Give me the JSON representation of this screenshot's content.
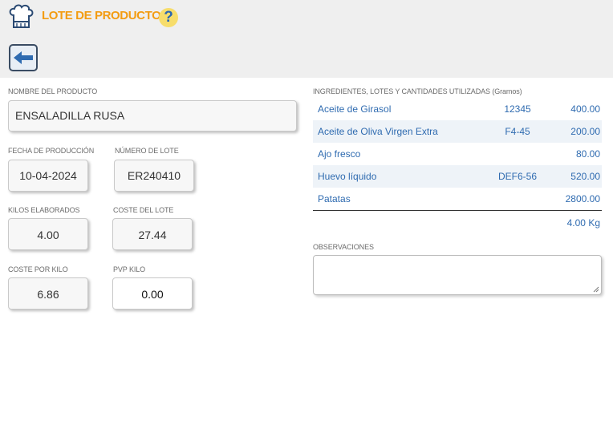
{
  "header": {
    "title": "LOTE DE PRODUCTO",
    "help_icon": "?",
    "icons": {
      "app": "chef-hat-icon",
      "help": "help-icon",
      "back": "back-arrow-icon"
    },
    "accent_color": "#f39c12",
    "link_color": "#2f6bb0"
  },
  "product": {
    "name_label": "NOMBRE DEL PRODUCTO",
    "name_value": "ENSALADILLA RUSA",
    "date_label": "FECHA DE PRODUCCIÓN",
    "date_value": "10-04-2024",
    "lot_label": "NÚMERO DE LOTE",
    "lot_value": "ER240410",
    "kilos_label": "KILOS ELABORADOS",
    "kilos_value": "4.00",
    "cost_label": "COSTE DEL LOTE",
    "cost_value": "27.44",
    "cost_kg_label": "COSTE POR KILO",
    "cost_kg_value": "6.86",
    "pvp_label": "PVP KILO",
    "pvp_value": "0.00"
  },
  "ingredients": {
    "label": "INGREDIENTES, LOTES Y CANTIDADES UTILIZADAS (Gramos)",
    "rows": [
      {
        "name": "Aceite de Girasol",
        "lot": "12345",
        "qty": "400.00"
      },
      {
        "name": "Aceite de Oliva Virgen Extra",
        "lot": "F4-45",
        "qty": "200.00"
      },
      {
        "name": "Ajo fresco",
        "lot": "",
        "qty": "80.00"
      },
      {
        "name": "Huevo líquido",
        "lot": "DEF6-56",
        "qty": "520.00"
      },
      {
        "name": "Patatas",
        "lot": "",
        "qty": "2800.00"
      }
    ],
    "total": "4.00 Kg"
  },
  "observations": {
    "label": "OBSERVACIONES",
    "value": ""
  }
}
